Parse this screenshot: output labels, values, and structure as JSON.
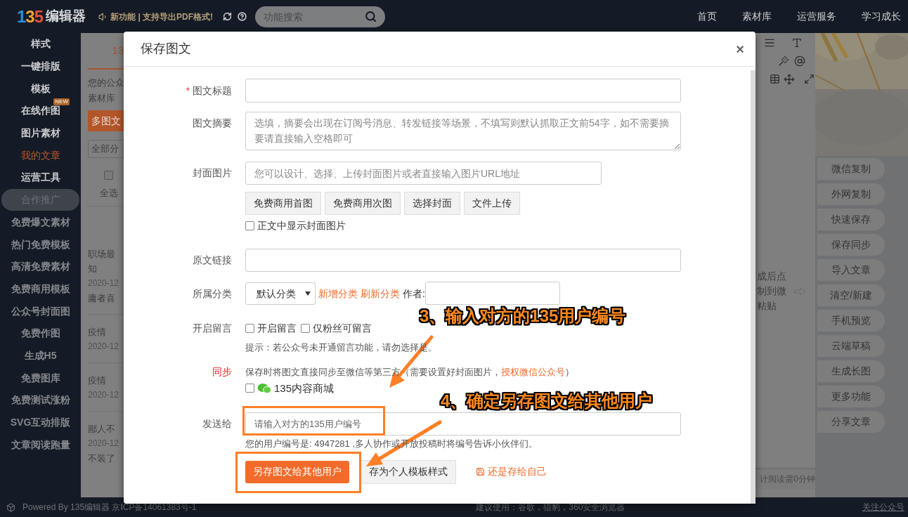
{
  "header": {
    "logo": {
      "digits": "135",
      "name": "编辑器"
    },
    "notice": "新功能 | 支持导出PDF格式!",
    "search": {
      "placeholder": "功能搜索"
    },
    "nav": [
      "首页",
      "素材库",
      "运营服务",
      "学习成长"
    ]
  },
  "sidebar": {
    "items": [
      {
        "label": "样式",
        "kind": "main",
        "selected": false
      },
      {
        "label": "一键排版",
        "kind": "main",
        "selected": false
      },
      {
        "label": "模板",
        "kind": "main",
        "selected": false
      },
      {
        "label": "在线作图",
        "kind": "main",
        "selected": false,
        "badge": "NEW"
      },
      {
        "label": "图片素材",
        "kind": "main",
        "selected": false
      },
      {
        "label": "我的文章",
        "kind": "main",
        "selected": true
      },
      {
        "label": "运营工具",
        "kind": "main",
        "selected": false
      },
      {
        "label": "合作推广",
        "kind": "promo",
        "selected": false
      },
      {
        "label": "免费爆文素材",
        "kind": "extra",
        "selected": false
      },
      {
        "label": "热门免费模板",
        "kind": "extra",
        "selected": false
      },
      {
        "label": "高清免费素材",
        "kind": "extra",
        "selected": false
      },
      {
        "label": "免费商用模板",
        "kind": "extra",
        "selected": false
      },
      {
        "label": "公众号封面图",
        "kind": "extra",
        "selected": false
      },
      {
        "label": "免费作图",
        "kind": "extra",
        "selected": false
      },
      {
        "label": "生成H5",
        "kind": "extra",
        "selected": false
      },
      {
        "label": "免费图库",
        "kind": "extra",
        "selected": false
      },
      {
        "label": "免费测试涨粉",
        "kind": "extra",
        "selected": false
      },
      {
        "label": "SVG互动排版",
        "kind": "extra",
        "selected": false
      },
      {
        "label": "文章阅读跑量",
        "kind": "extra",
        "selected": false
      }
    ]
  },
  "articles_panel": {
    "tab": "13",
    "intro": [
      "您的公众",
      "素材库"
    ],
    "button": "多图文",
    "select": "全部分",
    "select_all": {
      "label": "全选",
      "checked": false
    },
    "articles": [
      {
        "title": [
          "职场最",
          "知"
        ],
        "date": "2020-12",
        "summary": "庸者喜"
      },
      {
        "title": [
          "疫情"
        ],
        "date": "2020-12"
      },
      {
        "title": [
          "疫情"
        ],
        "date": "2020-12"
      },
      {
        "title": [
          "鄙人不"
        ],
        "date": "2020-12",
        "summary": "不装了"
      }
    ]
  },
  "editor": {
    "hint_lines": [
      "成后点",
      "制到微",
      "粘贴"
    ],
    "reading_time": "计阅读需0分钟"
  },
  "right_panel": {
    "buttons": [
      "微信复制",
      "外网复制",
      "快速保存",
      "保存同步",
      "导入文章",
      "清空/新建",
      "手机预览",
      "云端草稿",
      "生成长图",
      "更多功能",
      "分享文章"
    ]
  },
  "footer": {
    "powered": "Powered By 135编辑器 京ICP备14061383号-1",
    "browsers": "建议使用：谷歌，猎豹，360安全浏览器",
    "follow": "关注公众号"
  },
  "modal": {
    "title": "保存图文",
    "close": "×",
    "title_field": {
      "label": "图文标题",
      "required_mark": "*"
    },
    "summary_field": {
      "label": "图文摘要",
      "placeholder": "选填，摘要会出现在订阅号消息、转发链接等场景，不填写则默认抓取正文前54字，如不需要摘要请直接输入空格即可"
    },
    "cover_field": {
      "label": "封面图片",
      "placeholder": "您可以设计、选择、上传封面图片或者直接输入图片URL地址",
      "buttons": [
        "免费商用首图",
        "免费商用次图",
        "选择封面",
        "文件上传"
      ],
      "show_in_body": {
        "label": "正文中显示封面图片",
        "checked": false
      }
    },
    "link_field": {
      "label": "原文链接"
    },
    "category": {
      "label": "所属分类",
      "value": "默认分类",
      "links": [
        "新增分类",
        "刷新分类"
      ],
      "author_label": "作者:"
    },
    "comments": {
      "label": "开启留言",
      "options": [
        {
          "label": "开启留言",
          "checked": false
        },
        {
          "label": "仅粉丝可留言",
          "checked": false
        }
      ],
      "hint": "提示：若公众号未开通留言功能，请勿选择是。"
    },
    "sync": {
      "label": "同步",
      "text": "保存时将图文直接同步至微信等第三方（需要设置好封面图片，",
      "link": "授权微信公众号",
      "text_end": "）",
      "option": {
        "label": "135内容商城",
        "checked": false
      }
    },
    "send_to": {
      "label": "发送给",
      "placeholder": "请输入对方的135用户编号",
      "hint": "您的用户编号是: 4947281 ,多人协作或开放投稿时将编号告诉小伙伴们。"
    },
    "actions": [
      {
        "label": "另存图文给其他用户",
        "kind": "primary"
      },
      {
        "label": "存为个人模板样式",
        "kind": "secondary"
      },
      {
        "label": "还是存给自己",
        "kind": "link"
      }
    ]
  },
  "annotations": [
    {
      "text": "3、输入对方的135用户编号"
    },
    {
      "text": "4、确定另存图文给其他用户"
    }
  ]
}
